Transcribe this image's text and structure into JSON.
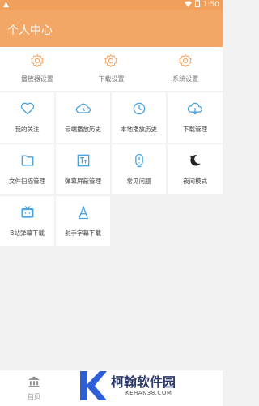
{
  "statusbar": {
    "time": "1:50"
  },
  "header": {
    "title": "个人中心"
  },
  "settings": [
    {
      "label": "播放器设置"
    },
    {
      "label": "下载设置"
    },
    {
      "label": "系统设置"
    }
  ],
  "grid": [
    {
      "label": "我的关注",
      "icon": "heart-icon"
    },
    {
      "label": "云端播放历史",
      "icon": "cloud-icon"
    },
    {
      "label": "本地播放历史",
      "icon": "history-icon"
    },
    {
      "label": "下载管理",
      "icon": "cloud-download-icon"
    },
    {
      "label": "文件扫描管理",
      "icon": "folder-icon"
    },
    {
      "label": "弹幕屏蔽管理",
      "icon": "text-filter-icon"
    },
    {
      "label": "常见问题",
      "icon": "faq-icon"
    },
    {
      "label": "夜间模式",
      "icon": "moon-icon"
    },
    {
      "label": "B站弹幕下载",
      "icon": "tv-icon"
    },
    {
      "label": "射手字幕下载",
      "icon": "subtitle-icon"
    }
  ],
  "tabbar": {
    "home_label": "首页"
  },
  "watermark": {
    "text": "柯翰软件园",
    "sub": "KEHAN38.COM"
  },
  "colors": {
    "accent": "#f3a766",
    "icon_blue": "#4aa3df",
    "watermark": "#2d3a6b"
  }
}
